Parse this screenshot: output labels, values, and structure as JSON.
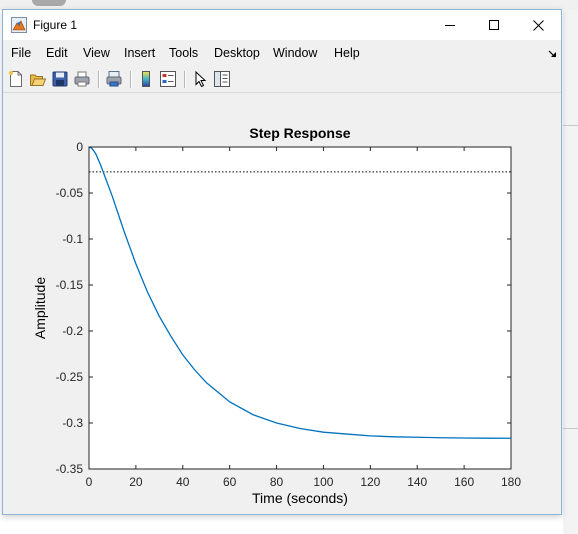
{
  "window": {
    "title": "Figure 1",
    "app_icon": "matlab-figure-icon"
  },
  "menu": {
    "items": [
      "File",
      "Edit",
      "View",
      "Insert",
      "Tools",
      "Desktop",
      "Window",
      "Help"
    ]
  },
  "toolbar": {
    "icons": [
      "new-figure-icon",
      "open-file-icon",
      "save-icon",
      "print-icon",
      "link-plot-icon",
      "insert-colorbar-icon",
      "insert-legend-icon",
      "edit-plot-pointer-icon",
      "property-inspector-icon"
    ]
  },
  "chart_data": {
    "type": "line",
    "title": "Step Response",
    "xlabel": "Time (seconds)",
    "ylabel": "Amplitude",
    "xlim": [
      0,
      180
    ],
    "ylim": [
      -0.35,
      0
    ],
    "xticks": [
      "0",
      "20",
      "40",
      "60",
      "80",
      "100",
      "120",
      "140",
      "160",
      "180"
    ],
    "yticks": [
      "0",
      "-0.05",
      "-0.1",
      "-0.15",
      "-0.2",
      "-0.25",
      "-0.3",
      "-0.35"
    ],
    "grid": false,
    "series": [
      {
        "x": [
          0,
          1,
          2,
          3,
          5,
          7.5,
          10,
          15,
          20,
          25,
          30,
          35,
          40,
          45,
          50,
          60,
          70,
          80,
          90,
          100,
          110,
          120,
          130,
          140,
          150,
          160,
          170,
          180
        ],
        "y": [
          0,
          -0.001,
          -0.004,
          -0.008,
          -0.02,
          -0.037,
          -0.054,
          -0.092,
          -0.127,
          -0.158,
          -0.184,
          -0.206,
          -0.226,
          -0.242,
          -0.256,
          -0.277,
          -0.291,
          -0.3,
          -0.306,
          -0.31,
          -0.312,
          -0.314,
          -0.315,
          -0.3155,
          -0.316,
          -0.3163,
          -0.3165,
          -0.3166
        ],
        "color": "#0072bd"
      }
    ],
    "reference_line": {
      "y": -0.027,
      "style": "dotted",
      "color": "#000000"
    }
  }
}
